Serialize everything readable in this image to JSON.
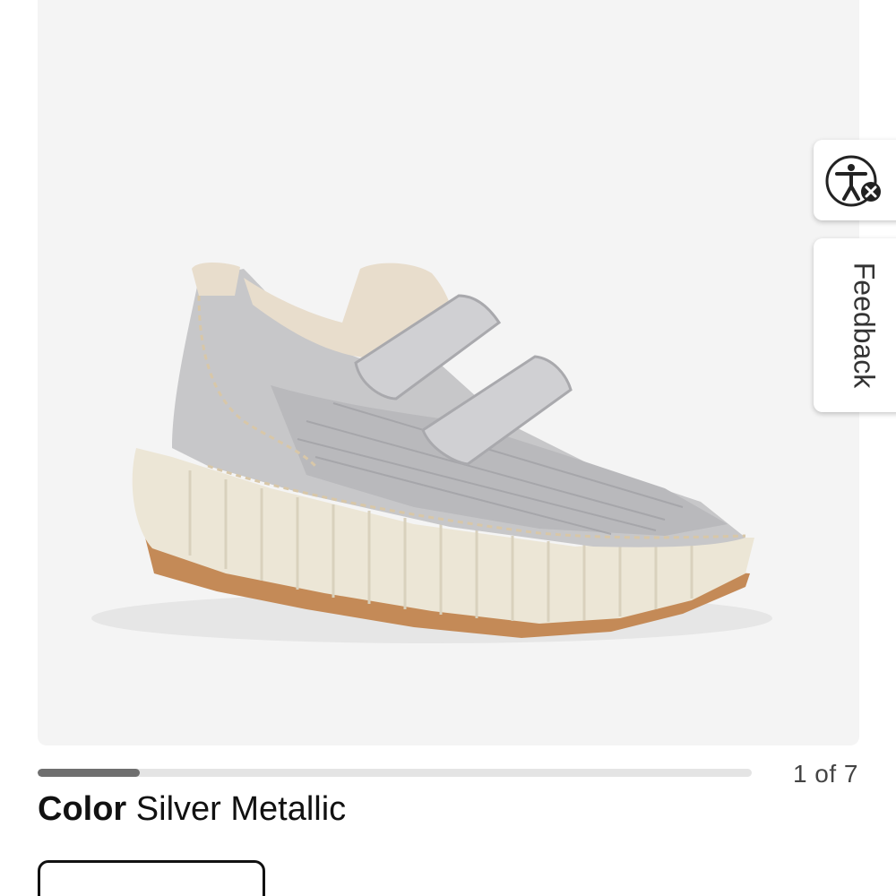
{
  "gallery": {
    "image_alt": "Silver metallic woven sneaker with double hook-and-loop straps on a cream ridged platform sole",
    "progress": 0.143,
    "counter": "1 of 7"
  },
  "product": {
    "color_label": "Color",
    "color_value": "Silver Metallic"
  },
  "widgets": {
    "accessibility_icon": "accessibility-icon",
    "feedback_label": "Feedback"
  },
  "colors": {
    "gallery_bg": "#f4f4f4",
    "progress_track": "#e4e4e4",
    "progress_fill": "#6f6f6f",
    "text": "#111111"
  }
}
